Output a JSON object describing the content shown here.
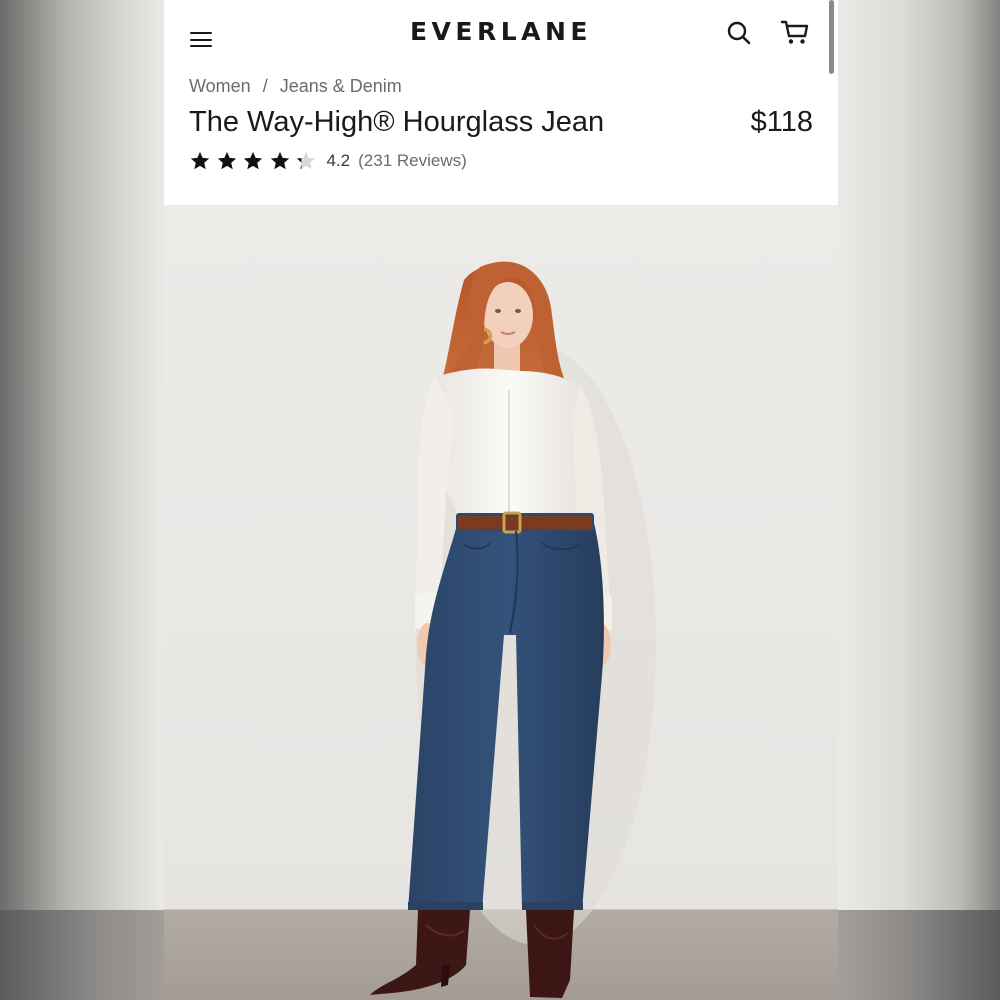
{
  "brand": {
    "logo": "EVERLANE"
  },
  "nav": {
    "menu_icon": "hamburger-menu-icon",
    "search_icon": "search-icon",
    "cart_icon": "shopping-cart-icon"
  },
  "breadcrumb": {
    "items": [
      "Women",
      "Jeans & Denim"
    ],
    "separator": "/"
  },
  "product": {
    "title": "The Way-High® Hourglass Jean",
    "price": "$118",
    "rating": 4.2,
    "rating_text": "4.2",
    "reviews_text": "(231 Reviews)",
    "stars": {
      "filled": 4,
      "total": 5
    }
  },
  "hero_image": {
    "subject": "model-photo"
  },
  "colors": {
    "text": "#1a1a1a",
    "muted": "#6b6b6b",
    "background": "#ffffff",
    "backdrop": "#ebe9e6",
    "denim": "#2f4a6e"
  }
}
